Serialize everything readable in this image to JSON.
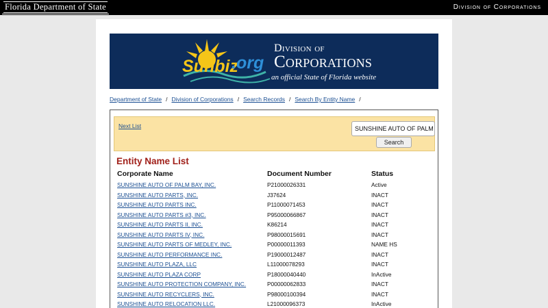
{
  "topbar": {
    "logo_text": "Florida Department of State",
    "division_link": "Division of Corporations"
  },
  "banner": {
    "sunbiz": "Sunbiz",
    "org": ".org",
    "division": "Division of",
    "corporations": "Corporations",
    "tagline": "an official State of Florida website"
  },
  "breadcrumb": [
    "Department of State",
    "Division of Corporations",
    "Search Records",
    "Search By Entity Name"
  ],
  "search": {
    "next_link": "Next List",
    "input_value": "SUNSHINE AUTO OF PALM B",
    "button_label": "Search"
  },
  "list": {
    "title": "Entity Name List",
    "columns": [
      "Corporate Name",
      "Document Number",
      "Status"
    ],
    "rows": [
      {
        "name": "SUNSHINE AUTO OF PALM BAY, INC.",
        "doc": "P21000026331",
        "status": "Active"
      },
      {
        "name": "SUNSHINE AUTO PARTS, INC.",
        "doc": "J37624",
        "status": "INACT"
      },
      {
        "name": "SUNSHINE AUTO PARTS INC.",
        "doc": "P11000071453",
        "status": "INACT"
      },
      {
        "name": "SUNSHINE AUTO PARTS #3, INC.",
        "doc": "P95000066867",
        "status": "INACT"
      },
      {
        "name": "SUNSHINE AUTO PARTS II, INC.",
        "doc": "K86214",
        "status": "INACT"
      },
      {
        "name": "SUNSHINE AUTO PARTS IV, INC.",
        "doc": "P98000015691",
        "status": "INACT"
      },
      {
        "name": "SUNSHINE AUTO PARTS OF MEDLEY, INC.",
        "doc": "P00000011393",
        "status": "NAME HS"
      },
      {
        "name": "SUNSHINE AUTO PERFORMANCE INC.",
        "doc": "P19000012487",
        "status": "INACT"
      },
      {
        "name": "SUNSHINE AUTO PLAZA, LLC",
        "doc": "L11000078293",
        "status": "INACT"
      },
      {
        "name": "SUNSHINE AUTO PLAZA CORP",
        "doc": "P18000040440",
        "status": "InActive"
      },
      {
        "name": "SUNSHINE AUTO PROTECTION COMPANY, INC.",
        "doc": "P00000062833",
        "status": "INACT"
      },
      {
        "name": "SUNSHINE AUTO RECYCLERS, INC.",
        "doc": "P98000100394",
        "status": "INACT"
      },
      {
        "name": "SUNSHINE AUTO RELOCATION LLC.",
        "doc": "L21000096373",
        "status": "InActive"
      }
    ]
  },
  "colors": {
    "banner_bg": "#0d2c5a",
    "nav_band_bg": "#fbe3a4",
    "title_red": "#a0201a",
    "link_blue": "#1a4e92"
  }
}
